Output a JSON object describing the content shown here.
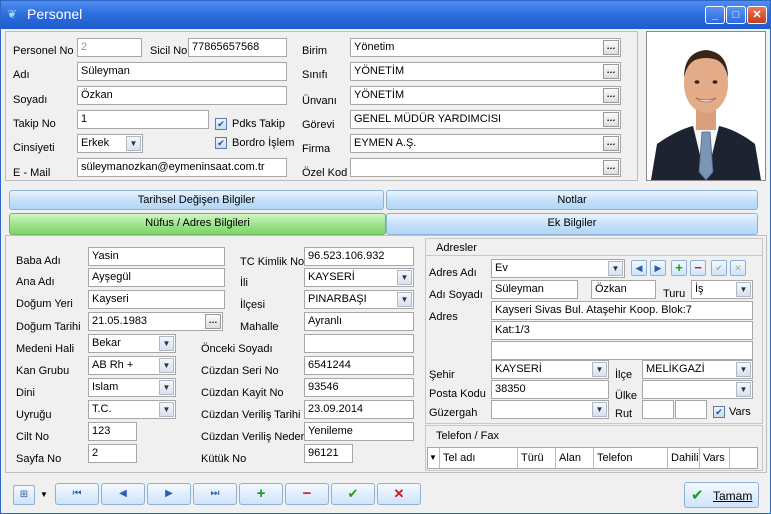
{
  "window": {
    "title": "Personel"
  },
  "top": {
    "personel_no_label": "Personel No",
    "personel_no": "2",
    "sicil_no_label": "Sicil No",
    "sicil_no": "77865657568",
    "adi_label": "Adı",
    "adi": "Süleyman",
    "soyadi_label": "Soyadı",
    "soyadi": "Özkan",
    "takip_no_label": "Takip No",
    "takip_no": "1",
    "pdks_label": "Pdks Takip",
    "cinsiyeti_label": "Cinsiyeti",
    "cinsiyeti": "Erkek",
    "bordro_label": "Bordro İşlem",
    "email_label": "E - Mail",
    "email": "süleymanozkan@eymeninsaat.com.tr",
    "birim_label": "Birim",
    "birim": "Yönetim",
    "sinifi_label": "Sınıfı",
    "sinifi": "YÖNETİM",
    "unvani_label": "Ünvanı",
    "unvani": "YÖNETİM",
    "gorevi_label": "Görevi",
    "gorevi": "GENEL MÜDÜR YARDIMCISI",
    "firma_label": "Firma",
    "firma": "EYMEN A.Ş.",
    "ozel_kod_label": "Özel Kod",
    "ozel_kod": ""
  },
  "tabs": {
    "tarihsel": "Tarihsel Değişen Bilgiler",
    "notlar": "Notlar",
    "nufus": "Nüfus / Adres Bilgileri",
    "ek": "Ek Bilgiler"
  },
  "nufus": {
    "baba_label": "Baba Adı",
    "baba": "Yasin",
    "ana_label": "Ana Adı",
    "ana": "Ayşegül",
    "dogum_yeri_label": "Doğum Yeri",
    "dogum_yeri": "Kayseri",
    "dogum_tarihi_label": "Doğum Tarihi",
    "dogum_tarihi": "21.05.1983",
    "medeni_label": "Medeni Hali",
    "medeni": "Bekar",
    "kan_label": "Kan Grubu",
    "kan": "AB Rh +",
    "dini_label": "Dini",
    "dini": "Islam",
    "uyrugu_label": "Uyruğu",
    "uyrugu": "T.C.",
    "cilt_label": "Cilt No",
    "cilt": "123",
    "sayfa_label": "Sayfa No",
    "sayfa": "2",
    "tc_label": "TC Kimlik No",
    "tc": "96.523.106.932",
    "il_label": "İli",
    "il": "KAYSERİ",
    "ilce_label": "İlçesi",
    "ilce": "PINARBAŞI",
    "mahalle_label": "Mahalle",
    "mahalle": "Ayranlı",
    "onceki_label": "Önceki Soyadı",
    "onceki": "",
    "seri_label": "Cüzdan Seri No",
    "seri": "6541244",
    "kayit_label": "Cüzdan Kayit No",
    "kayit": "93546",
    "verilis_t_label": "Cüzdan Veriliş Tarihi",
    "verilis_t": "23.09.2014",
    "verilis_n_label": "Cüzdan Veriliş Nedeni",
    "verilis_n": "Yenileme",
    "kutuk_label": "Kütük No",
    "kutuk": "96121"
  },
  "adres": {
    "section_title": "Adresler",
    "adres_adi_label": "Adres Adı",
    "adres_adi": "Ev",
    "adi_soyadi_label": "Adı Soyadı",
    "adi": "Süleyman",
    "soyadi": "Özkan",
    "turu_label": "Turu",
    "turu": "İş",
    "adres_label": "Adres",
    "adres1": "Kayseri Sivas Bul. Ataşehir Koop. Blok:7",
    "adres2": "Kat:1/3",
    "adres3": "",
    "sehir_label": "Şehir",
    "sehir": "KAYSERİ",
    "ilce_label": "İlçe",
    "ilce": "MELİKGAZİ",
    "posta_label": "Posta Kodu",
    "posta": "38350",
    "ulke_label": "Ülke",
    "ulke": "",
    "guzergah_label": "Güzergah",
    "guzergah": "",
    "rut_label": "Rut",
    "vars_label": "Vars"
  },
  "telefon": {
    "section_title": "Telefon / Fax",
    "columns": [
      "Tel adı",
      "Türü",
      "Alan",
      "Telefon",
      "Dahili",
      "Vars"
    ]
  },
  "footer": {
    "tamam": "Tamam"
  }
}
